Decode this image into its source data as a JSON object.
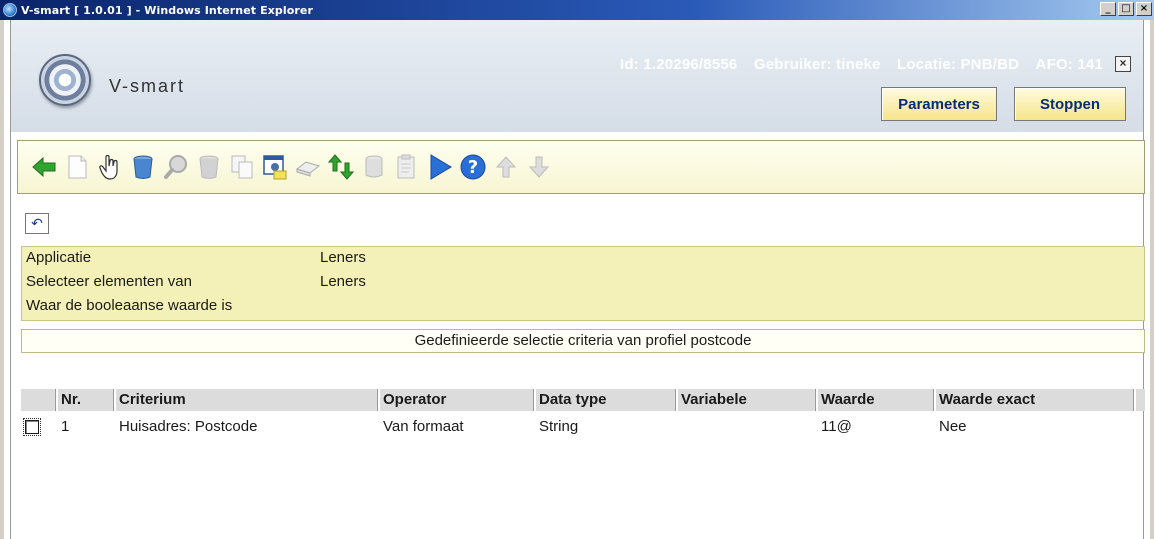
{
  "window": {
    "title": "V-smart [ 1.0.01 ] - Windows Internet Explorer",
    "controls": [
      "_",
      "□",
      "×"
    ]
  },
  "header": {
    "brand": "V-smart",
    "id": "Id: 1.20296/8556",
    "user": "Gebruiker: tineke",
    "location": "Locatie: PNB/BD",
    "afo": "AFO: 141",
    "close_label": "×",
    "parameters_label": "Parameters",
    "stop_label": "Stoppen"
  },
  "toolbar": {
    "icons": [
      "back-arrow-icon",
      "new-document-icon",
      "hand-select-icon",
      "delete-bin-icon",
      "search-icon",
      "delete-bin-disabled-icon",
      "copy-icon",
      "properties-icon",
      "eraser-icon",
      "sort-icon",
      "database-icon",
      "clipboard-icon",
      "play-icon",
      "help-icon",
      "up-arrow-icon",
      "down-arrow-icon"
    ]
  },
  "undo_label": "↶",
  "info": {
    "rows": [
      {
        "label": "Applicatie",
        "value": "Leners"
      },
      {
        "label": "Selecteer elementen van",
        "value": "Leners"
      },
      {
        "label": "Waar de booleaanse waarde is",
        "value": ""
      }
    ]
  },
  "section_title": "Gedefinieerde selectie criteria van profiel postcode",
  "table": {
    "headers": [
      "Nr.",
      "Criterium",
      "Operator",
      "Data type",
      "Variabele",
      "Waarde",
      "Waarde exact"
    ],
    "rows": [
      {
        "nr": "1",
        "criterium": "Huisadres: Postcode",
        "operator": "Van formaat",
        "data_type": "String",
        "variabele": "",
        "waarde": "11@",
        "waarde_exact": "Nee"
      }
    ]
  },
  "colors": {
    "accent_blue": "#0a246a",
    "info_bg": "#f4f1b8",
    "toolbar_bg": "#f7f5d2",
    "button_bg": "#f5e58a"
  }
}
